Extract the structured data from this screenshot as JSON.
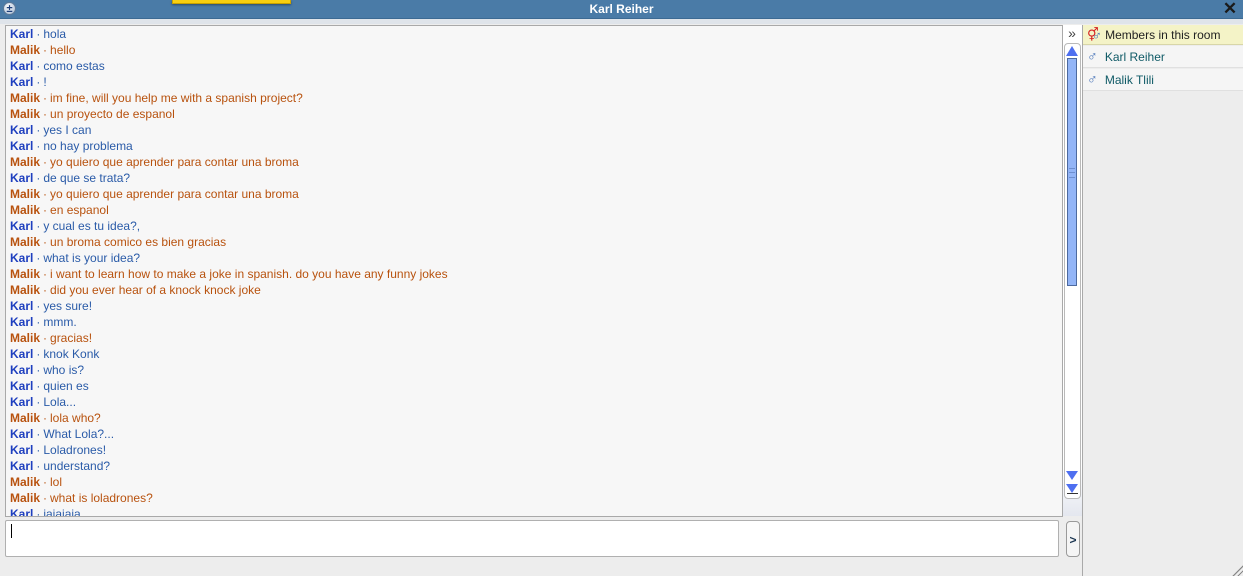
{
  "window": {
    "title": "Karl Reiher",
    "expand_icon": "plus-circle-icon",
    "close_icon": "close-icon",
    "close_glyph": "✕",
    "plus_glyph": "±"
  },
  "chat": {
    "separator": "·",
    "colors": {
      "karl": "#1e3fbf",
      "malik": "#b8520e"
    },
    "messages": [
      {
        "author": "Karl",
        "text": "hola"
      },
      {
        "author": "Malik",
        "text": "hello"
      },
      {
        "author": "Karl",
        "text": "como estas"
      },
      {
        "author": "Karl",
        "text": "!"
      },
      {
        "author": "Malik",
        "text": "im fine, will you help me with a spanish project?"
      },
      {
        "author": "Malik",
        "text": "un proyecto de espanol"
      },
      {
        "author": "Karl",
        "text": "yes  I can"
      },
      {
        "author": "Karl",
        "text": "no hay problema"
      },
      {
        "author": "Malik",
        "text": "yo quiero que aprender para contar una broma"
      },
      {
        "author": "Karl",
        "text": "de que se trata?"
      },
      {
        "author": "Malik",
        "text": "yo quiero que aprender para contar una broma"
      },
      {
        "author": "Malik",
        "text": "en espanol"
      },
      {
        "author": "Karl",
        "text": "y cual es tu idea?,"
      },
      {
        "author": "Malik",
        "text": "un broma comico es bien gracias"
      },
      {
        "author": "Karl",
        "text": "what is your idea?"
      },
      {
        "author": "Malik",
        "text": "i want to learn how to make a joke in spanish. do you have any funny jokes"
      },
      {
        "author": "Malik",
        "text": "did you ever hear of a knock knock joke"
      },
      {
        "author": "Karl",
        "text": "yes sure!"
      },
      {
        "author": "Karl",
        "text": "mmm."
      },
      {
        "author": "Malik",
        "text": "gracias!"
      },
      {
        "author": "Karl",
        "text": "knok Konk"
      },
      {
        "author": "Karl",
        "text": "who is?"
      },
      {
        "author": "Karl",
        "text": "quien es"
      },
      {
        "author": "Karl",
        "text": "Lola..."
      },
      {
        "author": "Malik",
        "text": "lola who?"
      },
      {
        "author": "Karl",
        "text": "What Lola?..."
      },
      {
        "author": "Karl",
        "text": "Loladrones!"
      },
      {
        "author": "Karl",
        "text": "understand?"
      },
      {
        "author": "Malik",
        "text": "lol"
      },
      {
        "author": "Malik",
        "text": "what is loladrones?"
      },
      {
        "author": "Karl",
        "text": "jajajaja"
      }
    ]
  },
  "scrollbar": {
    "collapse_glyph": "»",
    "thumb_position": "top"
  },
  "members": {
    "header": "Members in this room",
    "header_icon": "members-group-icon",
    "list": [
      {
        "name": "Karl Reiher",
        "icon": "male-icon"
      },
      {
        "name": "Malik Tlili",
        "icon": "male-icon"
      }
    ]
  },
  "composer": {
    "value": "",
    "send_label": ">"
  }
}
